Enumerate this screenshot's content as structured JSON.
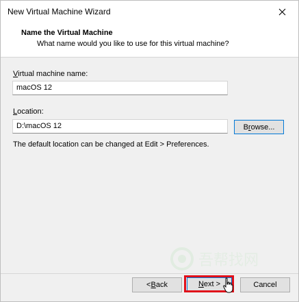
{
  "window": {
    "title": "New Virtual Machine Wizard",
    "close_icon": "close-icon"
  },
  "header": {
    "title": "Name the Virtual Machine",
    "subtitle": "What name would you like to use for this virtual machine?"
  },
  "form": {
    "vm_name_label_accel": "V",
    "vm_name_label_rest": "irtual machine name:",
    "vm_name_value": "macOS 12",
    "location_label_accel": "L",
    "location_label_rest": "ocation:",
    "location_value": "D:\\macOS 12",
    "browse_label_accel": "r",
    "browse_label_pre": "B",
    "browse_label_post": "owse...",
    "hint": "The default location can be changed at Edit > Preferences."
  },
  "footer": {
    "back_pre": "< ",
    "back_accel": "B",
    "back_post": "ack",
    "next_accel": "N",
    "next_post": "ext >",
    "cancel_label": "Cancel"
  },
  "overlay": {
    "highlight_color": "#e0101a",
    "watermark_text": "吾帮找网"
  }
}
